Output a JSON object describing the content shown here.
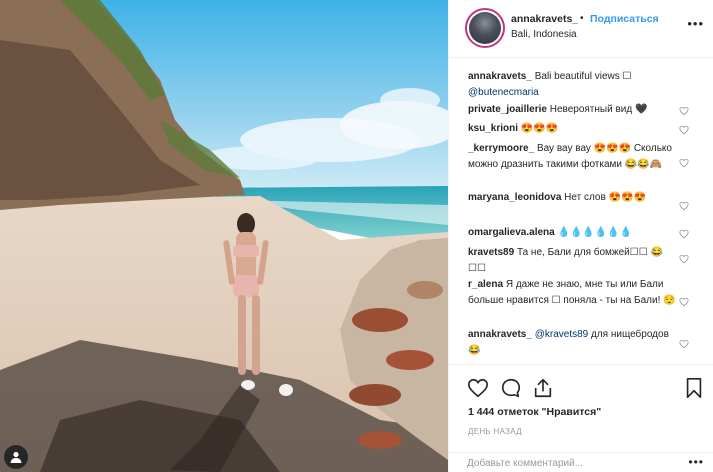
{
  "header": {
    "username": "annakravets_",
    "dot": "•",
    "follow_label": "Подписаться",
    "location": "Bali, Indonesia",
    "more_icon": "more-options-icon"
  },
  "comments": [
    {
      "user": "annakravets_",
      "text": "Bali beautiful views ☐",
      "mention": "@butenecmaria"
    },
    {
      "user": "private_joaillerie",
      "text": "Невероятный вид 🖤"
    },
    {
      "user": "ksu_krioni",
      "text": "😍😍😍"
    },
    {
      "user": "_kerrymoore_",
      "text": "Вау вау вау 😍😍😍 Сколько можно дразнить такими фотками 😂😂🙈"
    },
    {
      "user": "maryana_leonidova",
      "text": "Нет слов 😍😍😍"
    },
    {
      "user": "omargalieva.alena",
      "text": "💧💧💧💧💧💧"
    },
    {
      "user": "kravets89",
      "text": "Та не, Бали для бомжей☐☐ 😂☐☐"
    },
    {
      "user": "r_alena",
      "text": "Я даже не знаю, мне ты или Бали больше нравится ☐ поняла - ты на Бали! 😌"
    },
    {
      "user": "annakravets_",
      "mention": "@kravets89",
      "text": "для нищебродов😂"
    }
  ],
  "actions": {
    "likes": "1 444 отметок \"Нравится\"",
    "time": "ДЕНЬ НАЗАД"
  },
  "add_comment": {
    "placeholder": "Добавьте комментарий...",
    "more": "•••"
  },
  "colors": {
    "link": "#3897f0",
    "text": "#262626",
    "muted": "#999999",
    "border": "#efefef"
  }
}
